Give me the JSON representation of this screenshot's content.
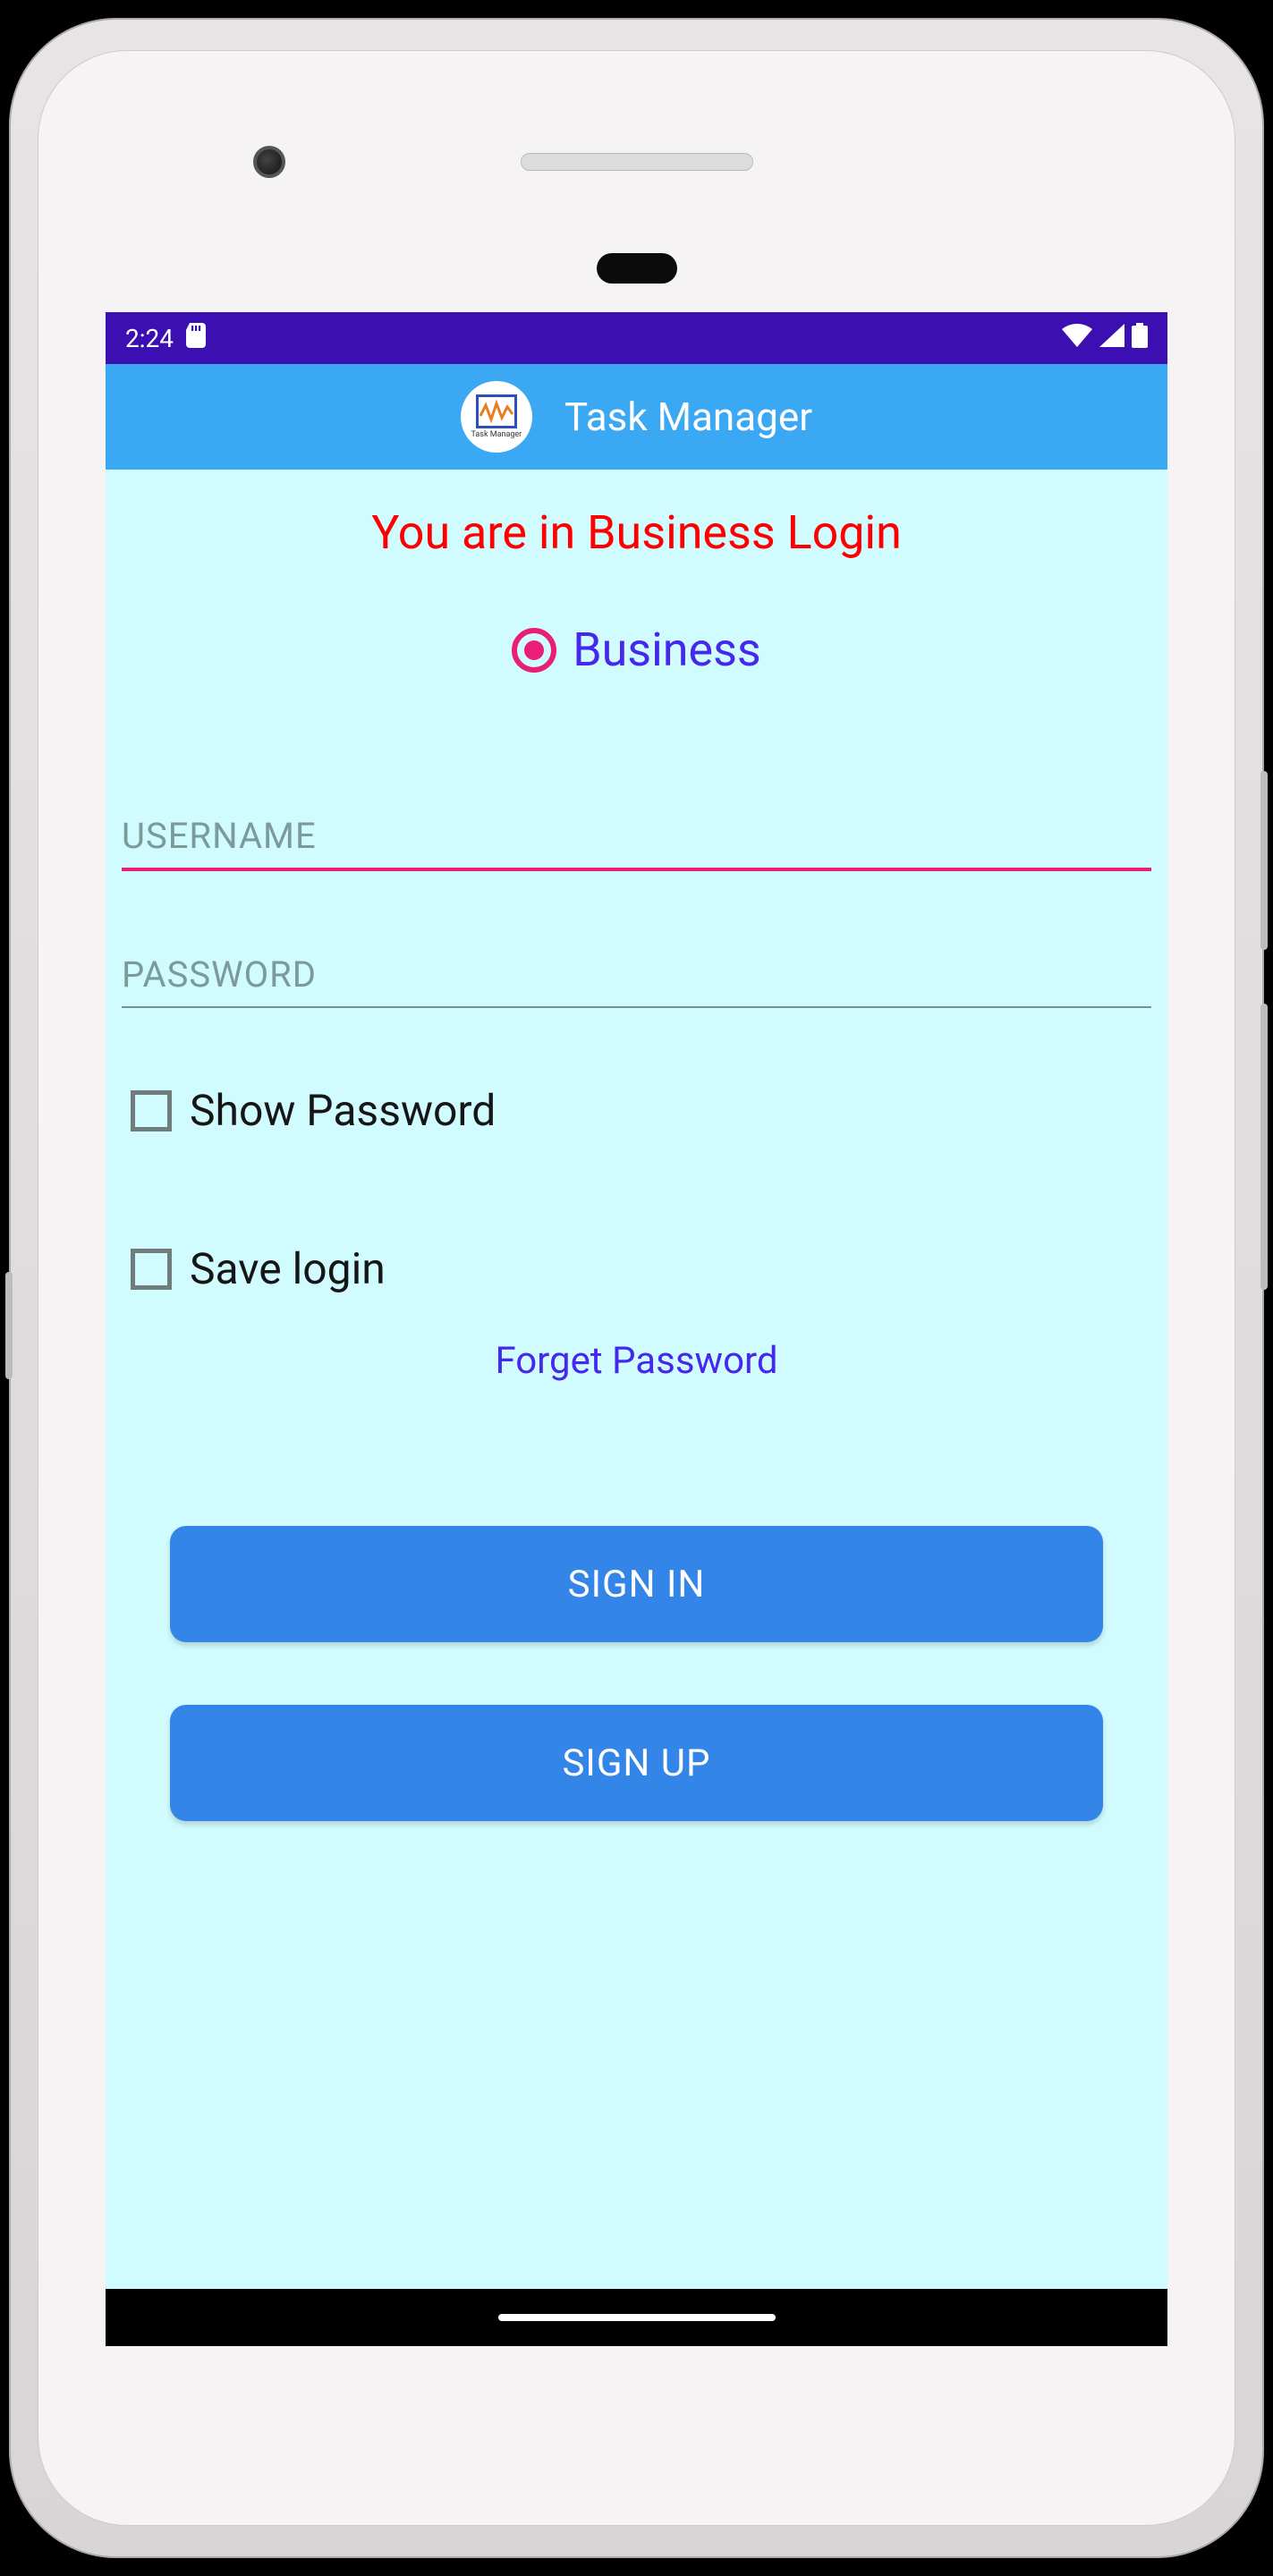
{
  "status": {
    "time": "2:24"
  },
  "topbar": {
    "title": "Task Manager",
    "logo_caption": "Task Manager"
  },
  "heading": "You are in Business Login",
  "radio": {
    "label": "Business"
  },
  "fields": {
    "username_placeholder": "USERNAME",
    "password_placeholder": "PASSWORD"
  },
  "checks": {
    "show_password": "Show Password",
    "save_login": "Save login"
  },
  "links": {
    "forget": "Forget Password"
  },
  "buttons": {
    "signin": "SIGN IN",
    "signup": "SIGN UP"
  }
}
